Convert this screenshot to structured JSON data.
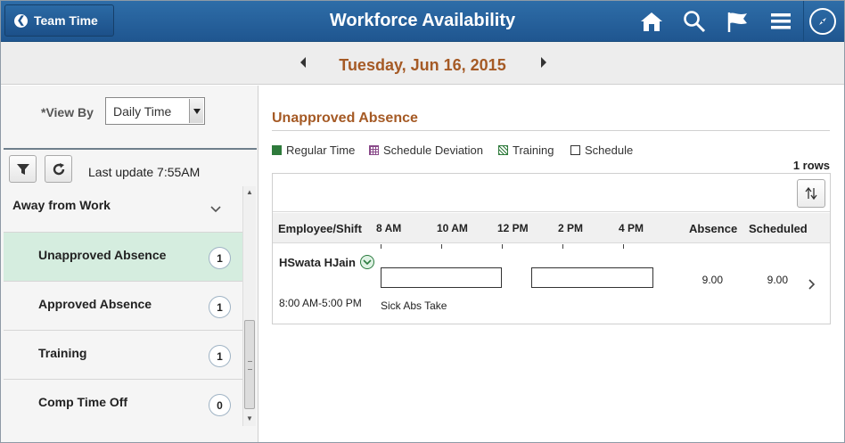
{
  "header": {
    "back_label": "Team Time",
    "title": "Workforce Availability",
    "icons": [
      "home-icon",
      "search-icon",
      "flag-icon",
      "menu-icon",
      "navbar-compass-icon"
    ]
  },
  "date_bar": {
    "date": "Tuesday, Jun 16, 2015"
  },
  "left_panel": {
    "view_by_label": "*View By",
    "view_by_value": "Daily Time",
    "last_update": "Last update 7:55AM",
    "group": {
      "title": "Away from Work",
      "items": [
        {
          "label": "Unapproved Absence",
          "count": "1",
          "active": true
        },
        {
          "label": "Approved Absence",
          "count": "1",
          "active": false
        },
        {
          "label": "Training",
          "count": "1",
          "active": false
        },
        {
          "label": "Comp Time Off",
          "count": "0",
          "active": false
        }
      ]
    }
  },
  "main": {
    "section_title": "Unapproved Absence",
    "legend": [
      {
        "label": "Regular Time",
        "color": "#2e7a3b",
        "pattern": "solid"
      },
      {
        "label": "Schedule Deviation",
        "color": "#8a4a8a",
        "pattern": "grid"
      },
      {
        "label": "Training",
        "color": "#2e7a3b",
        "pattern": "hatch"
      },
      {
        "label": "Schedule",
        "color": "#ffffff",
        "pattern": "empty"
      }
    ],
    "row_count": "1 rows",
    "columns": {
      "employee": "Employee/Shift",
      "times": [
        "8 AM",
        "10 AM",
        "12 PM",
        "2 PM",
        "4 PM"
      ],
      "absence": "Absence",
      "scheduled": "Scheduled"
    },
    "rows": [
      {
        "name": "HSwata HJain",
        "shift": "8:00 AM-5:00 PM",
        "bar_label": "Sick Abs Take",
        "absence": "9.00",
        "scheduled": "9.00"
      }
    ]
  },
  "colors": {
    "header_blue": "#1f5690",
    "accent_brown": "#a55a25",
    "active_green": "#d5eddf"
  }
}
